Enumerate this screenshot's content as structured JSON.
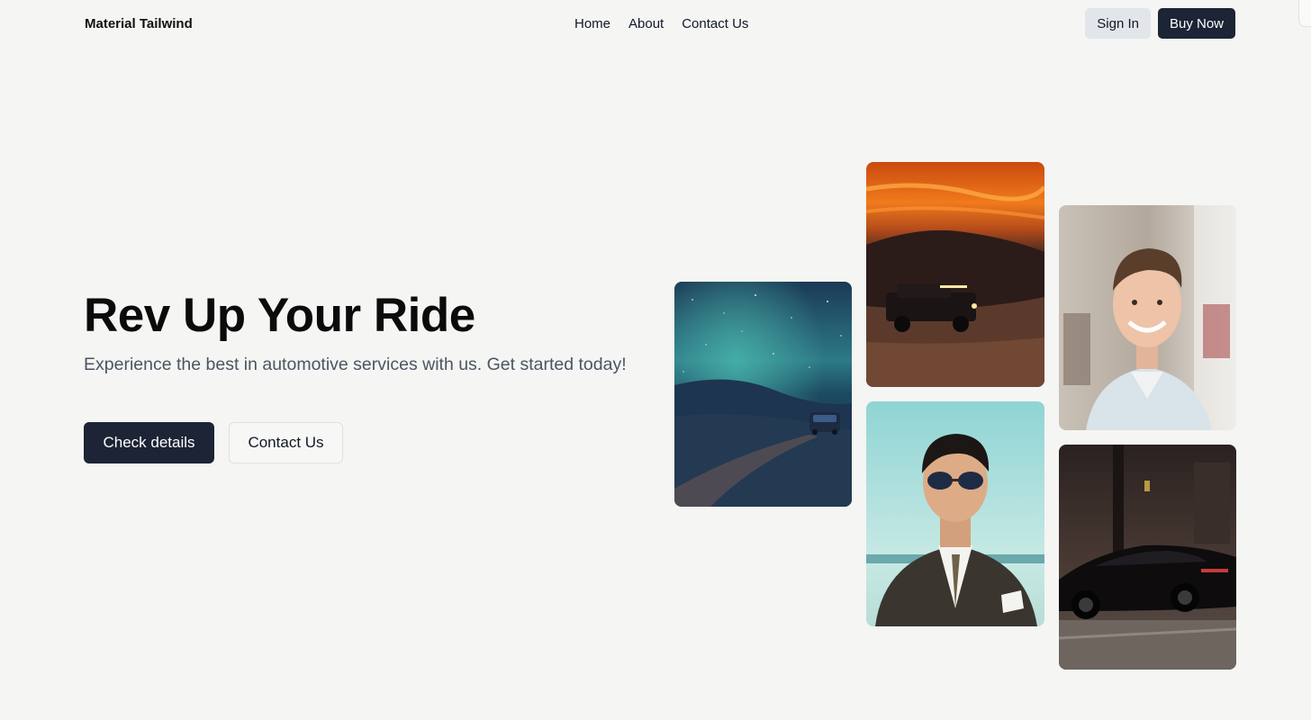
{
  "nav": {
    "brand": "Material Tailwind",
    "links": [
      "Home",
      "About",
      "Contact Us"
    ],
    "sign_in": "Sign In",
    "buy_now": "Buy Now"
  },
  "hero": {
    "title": "Rev Up Your Ride",
    "subtitle": "Experience the best in automotive services with us. Get started today!",
    "primary_button": "Check details",
    "secondary_button": "Contact Us"
  },
  "gallery": {
    "images": [
      "night-sky-desert-suv-photo",
      "sunset-dune-jeep-photo",
      "smiling-man-portrait-photo",
      "sunglasses-man-suit-photo",
      "black-sports-car-photo"
    ]
  },
  "colors": {
    "background": "#f5f5f3",
    "primary": "#1c2435",
    "secondary_button_bg": "#e2e6ea",
    "subtitle_text": "#4b5563"
  }
}
